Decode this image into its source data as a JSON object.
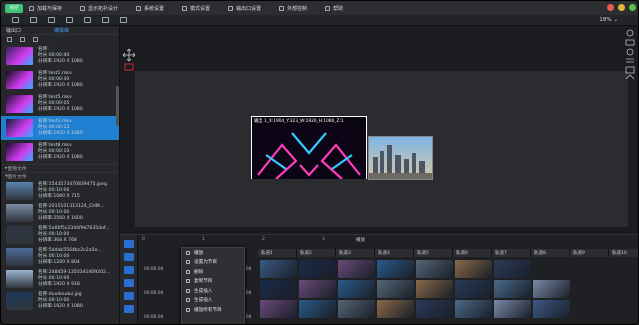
{
  "app": {
    "logo_text": "易控"
  },
  "menu": [
    {
      "label": "加载与保存",
      "icon": "save-icon"
    },
    {
      "label": "显示拓扑设计",
      "icon": "monitor-icon"
    },
    {
      "label": "系统设置",
      "icon": "gear-icon"
    },
    {
      "label": "模式设置",
      "icon": "mode-icon"
    },
    {
      "label": "输出口设置",
      "icon": "output-icon"
    },
    {
      "label": "外部控制",
      "icon": "remote-icon"
    },
    {
      "label": "帮助",
      "icon": "help-icon"
    }
  ],
  "zoom": "18%",
  "left_panel": {
    "tabs": [
      {
        "label": "输出口"
      },
      {
        "label": "媒体库"
      }
    ],
    "videos": [
      {
        "name": "名称:",
        "dur": "时长:00:00:40",
        "res": "分辨率:1920 X 1080"
      },
      {
        "name": "名称:test1.mkv",
        "dur": "时长:00:00:40",
        "res": "分辨率:1920 X 1080"
      },
      {
        "name": "名称:test5.mkv",
        "dur": "时长:00:00:05",
        "res": "分辨率:1920 X 1080"
      },
      {
        "name": "名称:test3.mkv",
        "dur": "时长:00:00:15",
        "res": "分辨率:1920 X 1080"
      },
      {
        "name": "名称:test8.mkv",
        "dur": "时长:00:00:10",
        "res": "分辨率:1920 X 1080"
      }
    ],
    "section_audio": "音频文件",
    "section_image": "图片文件",
    "images": [
      {
        "name": "名称:1543573470839475.jpeg",
        "dur": "时长:00:10:00",
        "res": "分辨率:1080 X 715"
      },
      {
        "name": "名称:2015101313124_CHM...",
        "dur": "时长:00:10:00",
        "res": "分辨率:2560 X 1600"
      },
      {
        "name": "名称:5a66f5c2344f9d7635daf...",
        "dur": "时长:00:10:00",
        "res": "分辨率:364 X 768"
      },
      {
        "name": "名称:5ddab5564bc2c2a5e...",
        "dur": "时长:00:10:00",
        "res": "分辨率:1200 X 804"
      },
      {
        "name": "名称:248459-1350341409202...",
        "dur": "时长:00:10:00",
        "res": "分辨率:1920 X 918"
      },
      {
        "name": "名称:duodoudui.jpg",
        "dur": "时长:00:10:00",
        "res": "分辨率:1920 X 1080"
      }
    ]
  },
  "stage": {
    "output_label": "输出 1_X:1904_Y:323_W:1920_H:1080_Z:1"
  },
  "timeline": {
    "ruler": [
      "0",
      "1",
      "2",
      "3"
    ],
    "head": "播放",
    "channels": [
      "轨道1",
      "轨道2",
      "轨道3",
      "轨道4",
      "轨道5",
      "轨道6",
      "轨道7",
      "轨道8",
      "轨道9",
      "轨道10"
    ],
    "timecodes": [
      "00:00:00",
      "00:00:00",
      "00:00:00",
      "00:00:00",
      "00:00:00",
      "00:00:00"
    ]
  },
  "context_menu": [
    "播放",
    "设置为节目",
    "删除",
    "复制节目",
    "生成插入",
    "生成插入",
    "播放所有节目"
  ],
  "colors": {
    "accent": "#1f7fd0",
    "bg": "#1b1c1f",
    "stage": "#2b2c2f"
  }
}
